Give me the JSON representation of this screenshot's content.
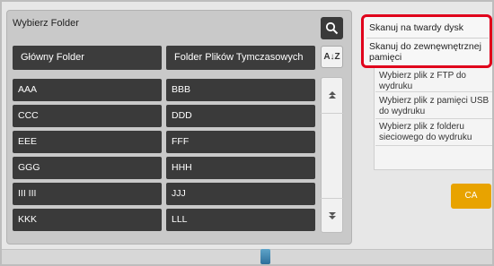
{
  "folder_panel": {
    "title": "Wybierz Folder",
    "header_main": "Główny Folder",
    "header_temp": "Folder Plików Tymczasowych",
    "sort_label": "A↓Z",
    "left_items": [
      "AAA",
      "CCC",
      "EEE",
      "GGG",
      "III III",
      "KKK"
    ],
    "right_items": [
      "BBB",
      "DDD",
      "FFF",
      "HHH",
      "JJJ",
      "LLL"
    ]
  },
  "side_menu": {
    "items": [
      "Wybierz plik z FTP do wydruku",
      "Wybierz plik z pamięci USB do wydruku",
      "Wybierz plik z folderu sieciowego do wydruku"
    ]
  },
  "popup_menu": {
    "items": [
      "Skanuj na twardy dysk",
      "Skanuj do zewnęwnętrznej pamięci"
    ]
  },
  "ca_button": {
    "label": "CA"
  },
  "colors": {
    "accent_orange": "#e8a300",
    "highlight_red": "#e0001b",
    "button_dark": "#3a3a3a"
  },
  "icons": {
    "search": "search-icon",
    "sort": "sort-icon",
    "scroll_up": "scroll-up-icon",
    "scroll_down": "scroll-down-icon"
  }
}
